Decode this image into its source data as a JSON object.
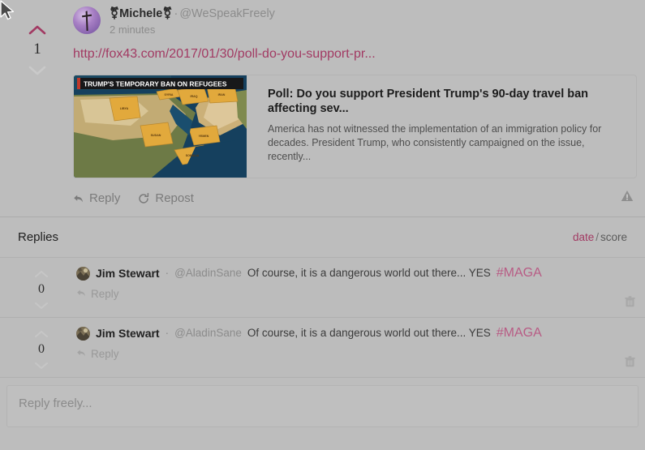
{
  "post": {
    "score": "1",
    "upvote_icon": "chevron-up-icon",
    "downvote_icon": "chevron-down-icon",
    "upvote_color": "#a23a63",
    "downvote_color": "#c9c9c9",
    "avatar_icon": "cross-avatar",
    "display_name": "⚧Michele⚧",
    "separator": "·",
    "handle": "@WeSpeakFreely",
    "timestamp": "2 minutes",
    "link_text": "http://fox43.com/2017/01/30/poll-do-you-support-pr...",
    "link_color": "#a23a63",
    "card": {
      "image_headline": "TRUMP'S TEMPORARY BAN ON REFUGEES",
      "image_labels": [
        "SYRIA",
        "IRAQ",
        "IRAN",
        "LIBYA",
        "SUDAN",
        "YEMEN",
        "SOMALIA"
      ],
      "title": "Poll: Do you support President Trump's 90-day travel ban affecting sev...",
      "description": "America has not witnessed the implementation of an immigration policy for decades. President Trump, who consistently campaigned on the issue, recently..."
    },
    "actions": [
      {
        "label": "Reply",
        "icon": "reply-arrow-icon"
      },
      {
        "label": "Repost",
        "icon": "repost-circular-arrow-icon"
      }
    ],
    "report_icon": "warning-triangle-icon"
  },
  "replies_section": {
    "title": "Replies",
    "sort_active": "date",
    "sort_divider": "/",
    "sort_inactive": "score"
  },
  "replies": [
    {
      "score": "0",
      "avatar_icon": "photo-avatar",
      "display_name": "Jim Stewart",
      "separator": "·",
      "handle": "@AladinSane",
      "text": "Of course, it is a dangerous world out there... YES",
      "hashtag": "#MAGA",
      "reply_label": "Reply",
      "reply_icon": "reply-arrow-icon",
      "delete_icon": "trash-icon"
    },
    {
      "score": "0",
      "avatar_icon": "photo-avatar",
      "display_name": "Jim Stewart",
      "separator": "·",
      "handle": "@AladinSane",
      "text": "Of course, it is a dangerous world out there... YES",
      "hashtag": "#MAGA",
      "reply_label": "Reply",
      "reply_icon": "reply-arrow-icon",
      "delete_icon": "trash-icon"
    }
  ],
  "composer": {
    "placeholder": "Reply freely...",
    "value": ""
  },
  "cursor": {
    "icon": "mouse-pointer-icon"
  },
  "colors": {
    "background": "#bdbdbd",
    "accent": "#a23a63",
    "hashtag": "#b85c85",
    "muted_text": "#8c8c8c"
  }
}
